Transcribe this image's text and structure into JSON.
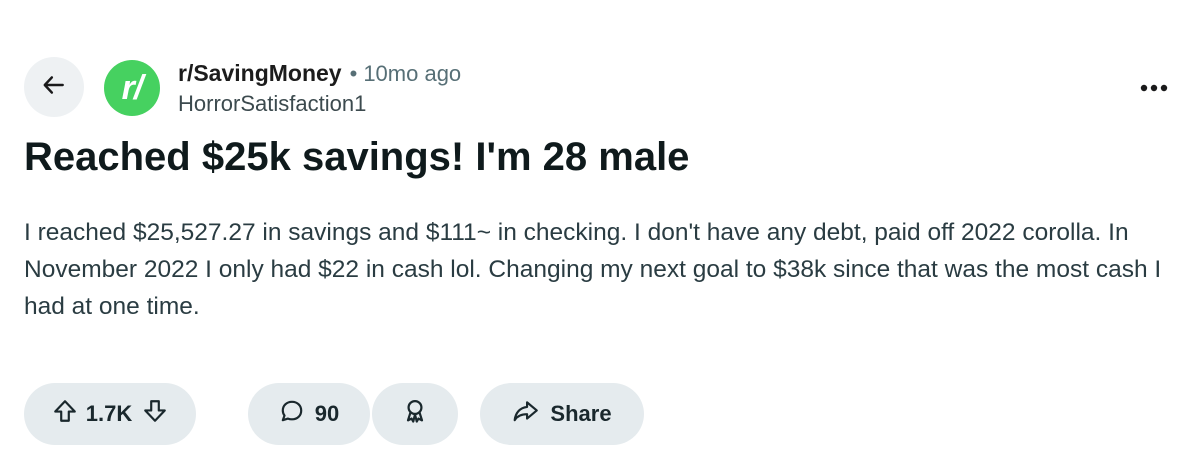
{
  "post": {
    "subreddit": "r/SavingMoney",
    "separator": "•",
    "time_ago": "10mo ago",
    "author": "HorrorSatisfaction1",
    "title": "Reached $25k savings! I'm 28 male",
    "body": "I reached $25,527.27 in savings and $111~ in checking. I don't have any debt, paid off 2022 corolla. In November 2022 I only had $22 in cash lol. Changing my next goal to $38k since that was the most cash I had at one time."
  },
  "avatar": {
    "text": "r/",
    "color": "#46d160"
  },
  "actions": {
    "vote_count": "1.7K",
    "comment_count": "90",
    "share_label": "Share"
  },
  "icons": {
    "back": "arrow-left-icon",
    "menu": "more-horizontal-icon",
    "upvote": "upvote-arrow-icon",
    "downvote": "downvote-arrow-icon",
    "comment": "comment-bubble-icon",
    "award": "award-icon",
    "share": "share-arrow-icon"
  }
}
